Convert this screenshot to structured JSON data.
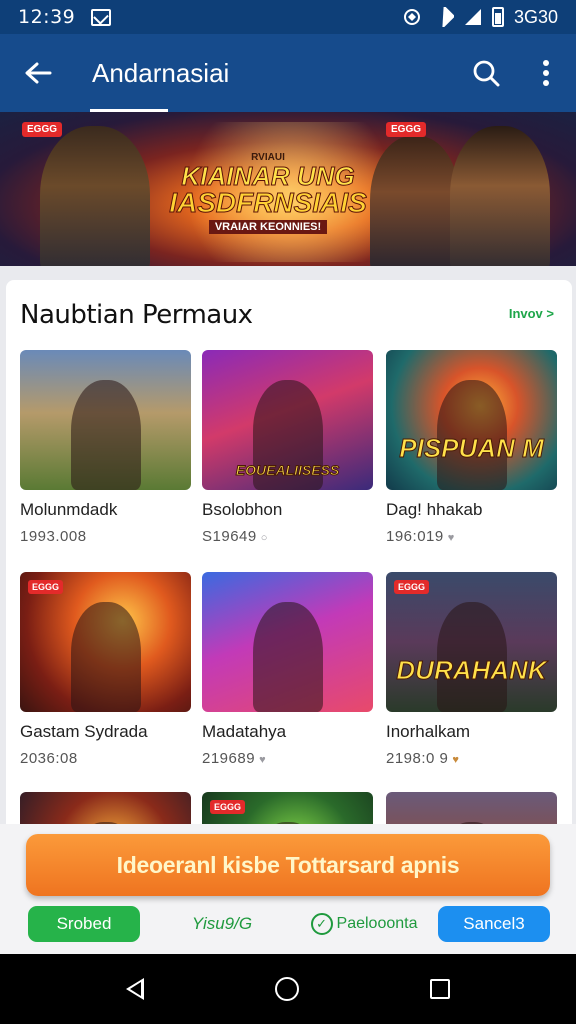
{
  "status_bar": {
    "time": "12:39",
    "battery_text": "3G30"
  },
  "app_bar": {
    "title": "Andarnasiai",
    "icons": [
      "back-arrow-icon",
      "search-icon",
      "more-vert-icon"
    ]
  },
  "banner": {
    "tag_left": "EGGG",
    "tag_right": "EGGG",
    "small_text": "RVIAUI",
    "line1": "KIAINAR UNG",
    "line2": "IASDFRNSIAIS",
    "line3": "VRAIAR KEONNIES!"
  },
  "section": {
    "title": "Naubtian Permaux",
    "more_label": "Invov >"
  },
  "games": [
    {
      "name": "Molunmdadk",
      "meta": "1993.008",
      "heart": false,
      "badge": "",
      "logo": ""
    },
    {
      "name": "Bsolobhon",
      "meta": "S19649",
      "heart": true,
      "heart_gold": false,
      "badge": "",
      "logo": "EOUEALIISESS"
    },
    {
      "name": "Dag! hhakab",
      "meta": "196:019",
      "heart": true,
      "heart_gold": false,
      "badge": "",
      "logo": "PISPUAN M"
    },
    {
      "name": "Gastam Sydrada",
      "meta": "2036:08",
      "heart": false,
      "badge": "EGGG",
      "logo": ""
    },
    {
      "name": "Madatahya",
      "meta": "219689",
      "heart": true,
      "heart_gold": false,
      "badge": "",
      "logo": ""
    },
    {
      "name": "Inorhalkam",
      "meta": "2198:0 9",
      "heart": true,
      "heart_gold": true,
      "badge": "EGGG",
      "logo": "DURAHANK"
    },
    {
      "name": "",
      "meta": "",
      "heart": false,
      "badge": "",
      "logo": ""
    },
    {
      "name": "",
      "meta": "",
      "heart": false,
      "badge": "EGGG",
      "logo": ""
    },
    {
      "name": "",
      "meta": "",
      "heart": false,
      "badge": "",
      "logo": ""
    }
  ],
  "cta_label": "Ideoeranl kisbe Tottarsard apnis",
  "bottom_buttons": {
    "saved": "Srobed",
    "vis": "Yisu9/G",
    "partner": "Paelooonta",
    "cancel": "Sancel3"
  },
  "colors": {
    "status_bar": "#0e3f78",
    "app_bar": "#164b8c",
    "cta": "#ef7420",
    "saved": "#26b34a",
    "cancel": "#1c8ff0"
  }
}
